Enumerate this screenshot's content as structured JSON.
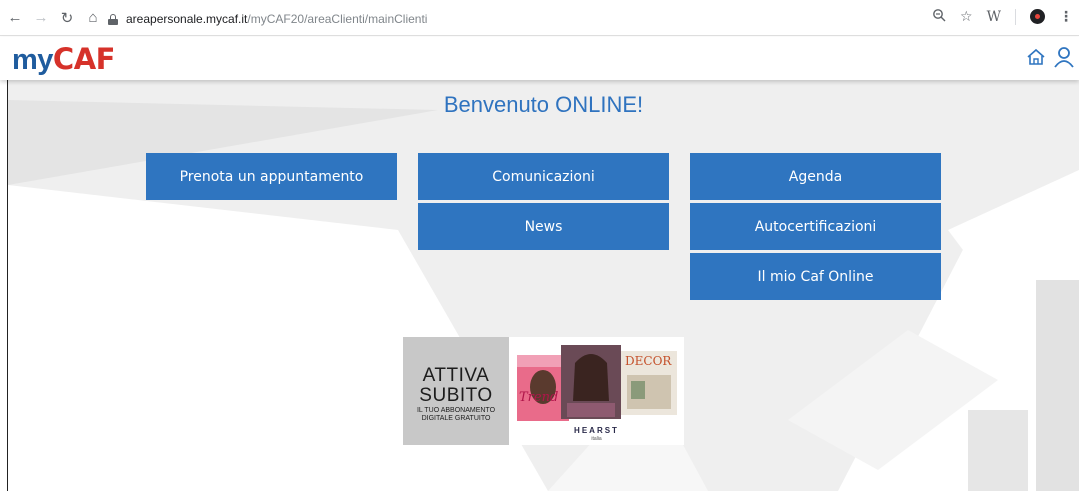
{
  "browser": {
    "url_host": "areapersonale.mycaf.it",
    "url_path": "/myCAF20/areaClienti/mainClienti",
    "ext_label": "W"
  },
  "header": {
    "logo_my": "my",
    "logo_caf": "CAF"
  },
  "main": {
    "welcome": "Benvenuto ONLINE!",
    "tiles": [
      "Prenota un appuntamento",
      "Comunicazioni",
      "Agenda",
      "News",
      "Autocertificazioni",
      "Il mio Caf Online"
    ]
  },
  "ad": {
    "line1": "ATTIVA",
    "line2": "SUBITO",
    "sub1": "IL TUO ABBONAMENTO",
    "sub2": "DIGITALE GRATUITO",
    "brand": "HEARST",
    "brand_sub": "italia",
    "mag1": "Trend",
    "mag3": "DECOR"
  },
  "colors": {
    "accent": "#2f75c0",
    "title": "#2f73bf",
    "logo_blue": "#1f5c9e",
    "logo_red": "#d6322a",
    "background": "#efefef"
  }
}
